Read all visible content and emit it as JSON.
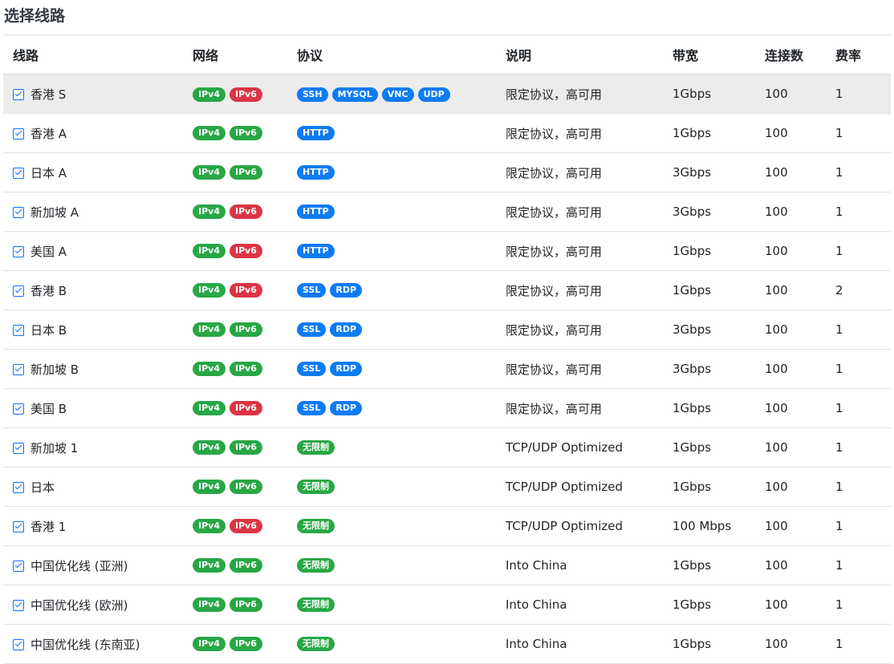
{
  "page_title": "选择线路",
  "colors": {
    "green": "#28a745",
    "red": "#dc3545",
    "blue": "#0d7bf2",
    "checkbox": "#0d6efd"
  },
  "headers": {
    "line": "线路",
    "network": "网络",
    "protocol": "协议",
    "description": "说明",
    "bandwidth": "带宽",
    "connections": "连接数",
    "rate": "费率"
  },
  "rows": [
    {
      "name": "香港 S",
      "checked": true,
      "networks": [
        {
          "label": "IPv4",
          "color": "green"
        },
        {
          "label": "IPv6",
          "color": "red"
        }
      ],
      "protocols": [
        {
          "label": "SSH",
          "color": "blue"
        },
        {
          "label": "MYSQL",
          "color": "blue"
        },
        {
          "label": "VNC",
          "color": "blue"
        },
        {
          "label": "UDP",
          "color": "blue"
        }
      ],
      "description": "限定协议，高可用",
      "bandwidth": "1Gbps",
      "connections": "100",
      "rate": "1"
    },
    {
      "name": "香港 A",
      "checked": true,
      "networks": [
        {
          "label": "IPv4",
          "color": "green"
        },
        {
          "label": "IPv6",
          "color": "green"
        }
      ],
      "protocols": [
        {
          "label": "HTTP",
          "color": "blue"
        }
      ],
      "description": "限定协议，高可用",
      "bandwidth": "1Gbps",
      "connections": "100",
      "rate": "1"
    },
    {
      "name": "日本 A",
      "checked": true,
      "networks": [
        {
          "label": "IPv4",
          "color": "green"
        },
        {
          "label": "IPv6",
          "color": "green"
        }
      ],
      "protocols": [
        {
          "label": "HTTP",
          "color": "blue"
        }
      ],
      "description": "限定协议，高可用",
      "bandwidth": "3Gbps",
      "connections": "100",
      "rate": "1"
    },
    {
      "name": "新加坡 A",
      "checked": true,
      "networks": [
        {
          "label": "IPv4",
          "color": "green"
        },
        {
          "label": "IPv6",
          "color": "red"
        }
      ],
      "protocols": [
        {
          "label": "HTTP",
          "color": "blue"
        }
      ],
      "description": "限定协议，高可用",
      "bandwidth": "3Gbps",
      "connections": "100",
      "rate": "1"
    },
    {
      "name": "美国 A",
      "checked": true,
      "networks": [
        {
          "label": "IPv4",
          "color": "green"
        },
        {
          "label": "IPv6",
          "color": "red"
        }
      ],
      "protocols": [
        {
          "label": "HTTP",
          "color": "blue"
        }
      ],
      "description": "限定协议，高可用",
      "bandwidth": "1Gbps",
      "connections": "100",
      "rate": "1"
    },
    {
      "name": "香港 B",
      "checked": true,
      "networks": [
        {
          "label": "IPv4",
          "color": "green"
        },
        {
          "label": "IPv6",
          "color": "red"
        }
      ],
      "protocols": [
        {
          "label": "SSL",
          "color": "blue"
        },
        {
          "label": "RDP",
          "color": "blue"
        }
      ],
      "description": "限定协议，高可用",
      "bandwidth": "1Gbps",
      "connections": "100",
      "rate": "2"
    },
    {
      "name": "日本 B",
      "checked": true,
      "networks": [
        {
          "label": "IPv4",
          "color": "green"
        },
        {
          "label": "IPv6",
          "color": "green"
        }
      ],
      "protocols": [
        {
          "label": "SSL",
          "color": "blue"
        },
        {
          "label": "RDP",
          "color": "blue"
        }
      ],
      "description": "限定协议，高可用",
      "bandwidth": "3Gbps",
      "connections": "100",
      "rate": "1"
    },
    {
      "name": "新加坡 B",
      "checked": true,
      "networks": [
        {
          "label": "IPv4",
          "color": "green"
        },
        {
          "label": "IPv6",
          "color": "green"
        }
      ],
      "protocols": [
        {
          "label": "SSL",
          "color": "blue"
        },
        {
          "label": "RDP",
          "color": "blue"
        }
      ],
      "description": "限定协议，高可用",
      "bandwidth": "3Gbps",
      "connections": "100",
      "rate": "1"
    },
    {
      "name": "美国 B",
      "checked": true,
      "networks": [
        {
          "label": "IPv4",
          "color": "green"
        },
        {
          "label": "IPv6",
          "color": "red"
        }
      ],
      "protocols": [
        {
          "label": "SSL",
          "color": "blue"
        },
        {
          "label": "RDP",
          "color": "blue"
        }
      ],
      "description": "限定协议，高可用",
      "bandwidth": "1Gbps",
      "connections": "100",
      "rate": "1"
    },
    {
      "name": "新加坡 1",
      "checked": true,
      "networks": [
        {
          "label": "IPv4",
          "color": "green"
        },
        {
          "label": "IPv6",
          "color": "green"
        }
      ],
      "protocols": [
        {
          "label": "无限制",
          "color": "green"
        }
      ],
      "description": "TCP/UDP Optimized",
      "bandwidth": "1Gbps",
      "connections": "100",
      "rate": "1"
    },
    {
      "name": "日本",
      "checked": true,
      "networks": [
        {
          "label": "IPv4",
          "color": "green"
        },
        {
          "label": "IPv6",
          "color": "green"
        }
      ],
      "protocols": [
        {
          "label": "无限制",
          "color": "green"
        }
      ],
      "description": "TCP/UDP Optimized",
      "bandwidth": "1Gbps",
      "connections": "100",
      "rate": "1"
    },
    {
      "name": "香港 1",
      "checked": true,
      "networks": [
        {
          "label": "IPv4",
          "color": "green"
        },
        {
          "label": "IPv6",
          "color": "red"
        }
      ],
      "protocols": [
        {
          "label": "无限制",
          "color": "green"
        }
      ],
      "description": "TCP/UDP Optimized",
      "bandwidth": "100 Mbps",
      "connections": "100",
      "rate": "1"
    },
    {
      "name": "中国优化线 (亚洲)",
      "checked": true,
      "networks": [
        {
          "label": "IPv4",
          "color": "green"
        },
        {
          "label": "IPv6",
          "color": "green"
        }
      ],
      "protocols": [
        {
          "label": "无限制",
          "color": "green"
        }
      ],
      "description": "Into China",
      "bandwidth": "1Gbps",
      "connections": "100",
      "rate": "1"
    },
    {
      "name": "中国优化线 (欧洲)",
      "checked": true,
      "networks": [
        {
          "label": "IPv4",
          "color": "green"
        },
        {
          "label": "IPv6",
          "color": "green"
        }
      ],
      "protocols": [
        {
          "label": "无限制",
          "color": "green"
        }
      ],
      "description": "Into China",
      "bandwidth": "1Gbps",
      "connections": "100",
      "rate": "1"
    },
    {
      "name": "中国优化线 (东南亚)",
      "checked": true,
      "networks": [
        {
          "label": "IPv4",
          "color": "green"
        },
        {
          "label": "IPv6",
          "color": "green"
        }
      ],
      "protocols": [
        {
          "label": "无限制",
          "color": "green"
        }
      ],
      "description": "Into China",
      "bandwidth": "1Gbps",
      "connections": "100",
      "rate": "1"
    }
  ]
}
